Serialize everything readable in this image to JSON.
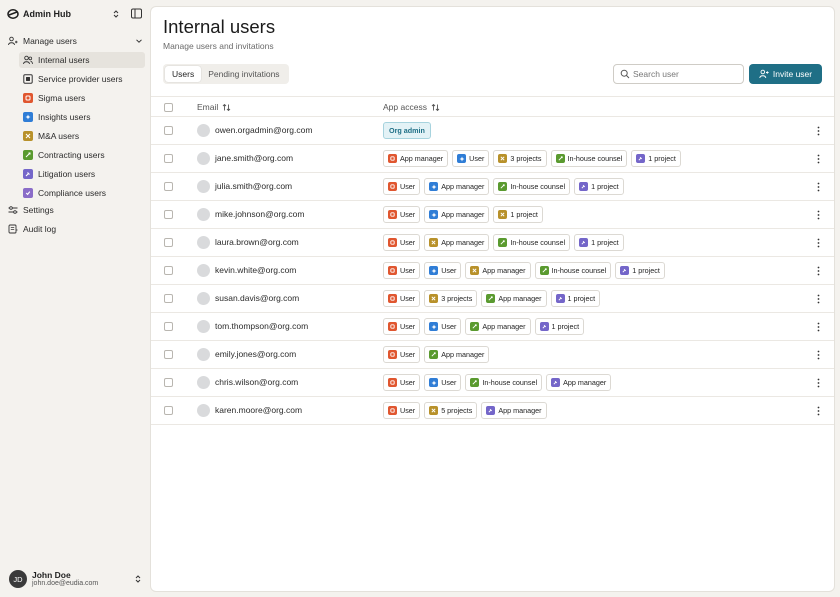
{
  "app": {
    "title": "Admin Hub"
  },
  "colors": {
    "accent": "#1f6f86",
    "user": "#e0562f",
    "app_manager": "#e0562f",
    "service": "#4d4d4d",
    "sigma": "#e0562f",
    "insights": "#2f7dd6",
    "mna": "#b8912a",
    "contracting": "#5a9a2f",
    "litigation": "#7466c9",
    "compliance": "#8a6cc8"
  },
  "sidebar": {
    "section": {
      "label": "Manage users",
      "icon": "users-icon",
      "expanded": true
    },
    "items": [
      {
        "label": "Internal users",
        "icon": "users-icon",
        "active": true
      },
      {
        "label": "Service provider users",
        "icon": "service-icon"
      },
      {
        "label": "Sigma users",
        "icon": "sigma-icon"
      },
      {
        "label": "Insights users",
        "icon": "insights-icon"
      },
      {
        "label": "M&A users",
        "icon": "mna-icon"
      },
      {
        "label": "Contracting users",
        "icon": "contracting-icon"
      },
      {
        "label": "Litigation users",
        "icon": "litigation-icon"
      },
      {
        "label": "Compliance users",
        "icon": "compliance-icon"
      }
    ],
    "settings_label": "Settings",
    "audit_label": "Audit log",
    "user": {
      "initials": "JD",
      "name": "John Doe",
      "email": "john.doe@eudia.com"
    }
  },
  "header": {
    "title": "Internal users",
    "subtitle": "Manage users and invitations",
    "tabs": [
      {
        "label": "Users",
        "active": true
      },
      {
        "label": "Pending invitations",
        "active": false
      }
    ],
    "search_placeholder": "Search user",
    "invite_label": "Invite user"
  },
  "table": {
    "columns": {
      "email": "Email",
      "access": "App access"
    },
    "rows": [
      {
        "email": "owen.orgadmin@org.com",
        "chips": [
          {
            "label": "Org admin",
            "type": "org"
          }
        ]
      },
      {
        "email": "jane.smith@org.com",
        "chips": [
          {
            "label": "App manager",
            "type": "sigma"
          },
          {
            "label": "User",
            "type": "insights"
          },
          {
            "label": "3 projects",
            "type": "mna"
          },
          {
            "label": "In-house counsel",
            "type": "contracting"
          },
          {
            "label": "1 project",
            "type": "litigation"
          }
        ]
      },
      {
        "email": "julia.smith@org.com",
        "chips": [
          {
            "label": "User",
            "type": "sigma"
          },
          {
            "label": "App manager",
            "type": "insights"
          },
          {
            "label": "In-house counsel",
            "type": "contracting"
          },
          {
            "label": "1 project",
            "type": "litigation"
          }
        ]
      },
      {
        "email": "mike.johnson@org.com",
        "chips": [
          {
            "label": "User",
            "type": "sigma"
          },
          {
            "label": "App manager",
            "type": "insights"
          },
          {
            "label": "1 project",
            "type": "mna"
          }
        ]
      },
      {
        "email": "laura.brown@org.com",
        "chips": [
          {
            "label": "User",
            "type": "sigma"
          },
          {
            "label": "App manager",
            "type": "mna"
          },
          {
            "label": "In-house counsel",
            "type": "contracting"
          },
          {
            "label": "1 project",
            "type": "litigation"
          }
        ]
      },
      {
        "email": "kevin.white@org.com",
        "chips": [
          {
            "label": "User",
            "type": "sigma"
          },
          {
            "label": "User",
            "type": "insights"
          },
          {
            "label": "App manager",
            "type": "mna"
          },
          {
            "label": "In-house counsel",
            "type": "contracting"
          },
          {
            "label": "1 project",
            "type": "litigation"
          }
        ]
      },
      {
        "email": "susan.davis@org.com",
        "chips": [
          {
            "label": "User",
            "type": "sigma"
          },
          {
            "label": "3 projects",
            "type": "mna"
          },
          {
            "label": "App manager",
            "type": "contracting"
          },
          {
            "label": "1 project",
            "type": "litigation"
          }
        ]
      },
      {
        "email": "tom.thompson@org.com",
        "chips": [
          {
            "label": "User",
            "type": "sigma"
          },
          {
            "label": "User",
            "type": "insights"
          },
          {
            "label": "App manager",
            "type": "contracting"
          },
          {
            "label": "1 project",
            "type": "litigation"
          }
        ]
      },
      {
        "email": "emily.jones@org.com",
        "chips": [
          {
            "label": "User",
            "type": "sigma"
          },
          {
            "label": "App manager",
            "type": "contracting"
          }
        ]
      },
      {
        "email": "chris.wilson@org.com",
        "chips": [
          {
            "label": "User",
            "type": "sigma"
          },
          {
            "label": "User",
            "type": "insights"
          },
          {
            "label": "In-house counsel",
            "type": "contracting"
          },
          {
            "label": "App manager",
            "type": "litigation"
          }
        ]
      },
      {
        "email": "karen.moore@org.com",
        "chips": [
          {
            "label": "User",
            "type": "sigma"
          },
          {
            "label": "5 projects",
            "type": "mna"
          },
          {
            "label": "App manager",
            "type": "litigation"
          }
        ]
      }
    ]
  }
}
